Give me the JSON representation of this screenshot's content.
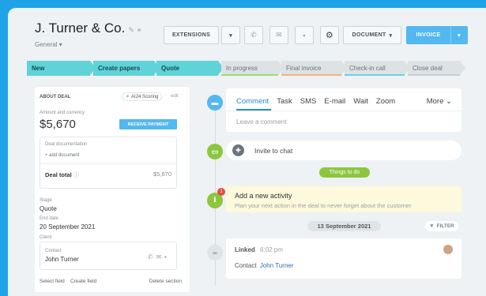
{
  "header": {
    "title": "J. Turner & Co.",
    "edit_icons": "✎ ⚭",
    "subtitle": "General ▾",
    "extensions_label": "EXTENSIONS",
    "document_label": "DOCUMENT",
    "invoice_label": "INVOICE"
  },
  "pipeline": {
    "stages": [
      "New",
      "Create papers",
      "Quote",
      "In progress",
      "Final invoice",
      "Check-in call",
      "Close deal"
    ]
  },
  "about": {
    "title": "ABOUT DEAL",
    "scoring": "AI24 Scoring",
    "edit": "edit",
    "amount_label": "Amount and currency",
    "amount": "$5,670",
    "receive_payment": "RECEIVE PAYMENT",
    "doc_label": "Deal documentation",
    "add_document": "+ add document",
    "deal_total_label": "Deal total",
    "deal_total": "$5,670",
    "stage_label": "Stage",
    "stage": "Quote",
    "end_date_label": "End date",
    "end_date": "20 September 2021",
    "client_label": "Client",
    "contact_label": "Contact",
    "contact": "John Turner",
    "select_field": "Select field",
    "create_field": "Create field",
    "delete_section": "Delete section"
  },
  "activity": {
    "tabs": [
      "Comment",
      "Task",
      "SMS",
      "E-mail",
      "Wait",
      "Zoom"
    ],
    "more": "More",
    "comment_placeholder": "Leave a comment",
    "invite": "Invite to chat",
    "things_to_do": "Things to do",
    "badge_count": "1",
    "new_activity_title": "Add a new activity",
    "new_activity_desc": "Plan your next action in the deal to never forget about the customer",
    "date_pill": "13 September 2021",
    "filter": "FILTER",
    "linked": "Linked",
    "linked_time": "6:02 pm",
    "contact_prefix": "Contact",
    "contact_name": "John Turner"
  },
  "colors": {
    "background": "#1fa3e8",
    "stage_done": "#5fd3d8",
    "stage_todo": "#dde2e5",
    "accent_blue": "#53b8f0",
    "green": "#8cc63f",
    "todo_bg": "#fdf9dc"
  }
}
